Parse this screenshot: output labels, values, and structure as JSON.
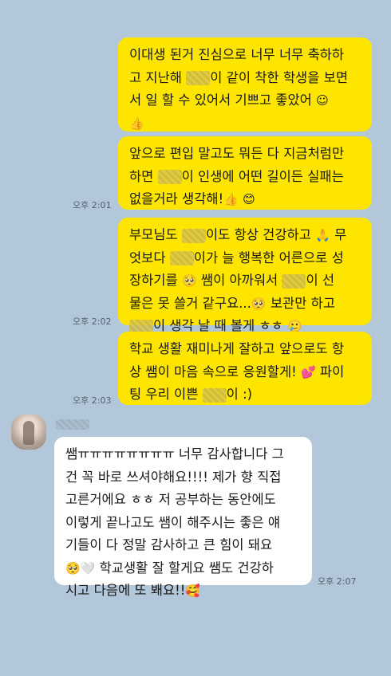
{
  "messages": [
    {
      "side": "out",
      "lines": [
        [
          "이대생 된거 진심으로 너무 너무 축하하"
        ],
        [
          "고 지난해 ",
          {
            "blur": true
          },
          "이 같이 착한 학생을 보면"
        ],
        [
          "서 일 할 수 있어서 기쁘고 좋았어 ",
          {
            "emoji": "☺"
          }
        ],
        [
          {
            "emoji": "👍"
          }
        ]
      ]
    },
    {
      "side": "out",
      "lines": [
        [
          "앞으로 편입 말고도 뭐든 다 지금처럼만"
        ],
        [
          "하면 ",
          {
            "blur": true
          },
          "이 인생에 어떤 길이든 실패는"
        ],
        [
          "없을거라 생각해!",
          {
            "emoji": "👍"
          },
          " ",
          {
            "emoji": "😊"
          }
        ]
      ],
      "time": "오후 2:01"
    },
    {
      "side": "out",
      "lines": [
        [
          "부모님도 ",
          {
            "blur": true
          },
          "이도 항상 건강하고 ",
          {
            "emoji": "🙏"
          },
          " 무"
        ],
        [
          "엇보다 ",
          {
            "blur": true
          },
          "이가 늘 행복한 어른으로 성"
        ],
        [
          "장하기를 ",
          {
            "emoji": "🥺"
          },
          " 쌤이 아까워서 ",
          {
            "blur": true
          },
          "이 선"
        ],
        [
          "물은 못 쓸거 같구요...",
          {
            "emoji": "🥺"
          },
          " 보관만 하고"
        ],
        [
          {
            "blur": true
          },
          "이 생각 날 때 볼게 ㅎㅎ ",
          {
            "emoji": "🥲"
          }
        ]
      ],
      "time": "오후 2:02"
    },
    {
      "side": "out",
      "lines": [
        [
          "학교 생활 재미나게 잘하고 앞으로도 항"
        ],
        [
          "상 쌤이 마음 속으로 응원할게! ",
          {
            "emoji": "💕"
          },
          " 파이"
        ],
        [
          "팅 우리 이쁜 ",
          {
            "blur": true
          },
          "이 :)"
        ]
      ],
      "time": "오후 2:03"
    },
    {
      "side": "in",
      "lines": [
        [
          "쌤ㅠㅠㅠㅠㅠㅠㅠㅠ 너무 감사합니다 그"
        ],
        [
          "건 꼭 바로 쓰셔야해요!!!! 제가 향 직접"
        ],
        [
          "고른거에요 ㅎㅎ 저 공부하는 동안에도"
        ],
        [
          "이렇게 끝나고도 쌤이 해주시는 좋은 얘"
        ],
        [
          "기들이 다 정말 감사하고 큰 힘이 돼요"
        ],
        [
          {
            "emoji": "🥺"
          },
          {
            "emoji": "🤍"
          },
          " 학교생활 잘 할게요 쌤도 건강하"
        ],
        [
          "시고 다음에 또 봬요!!",
          {
            "emoji": "🥰"
          }
        ]
      ],
      "time": "오후 2:07"
    }
  ]
}
